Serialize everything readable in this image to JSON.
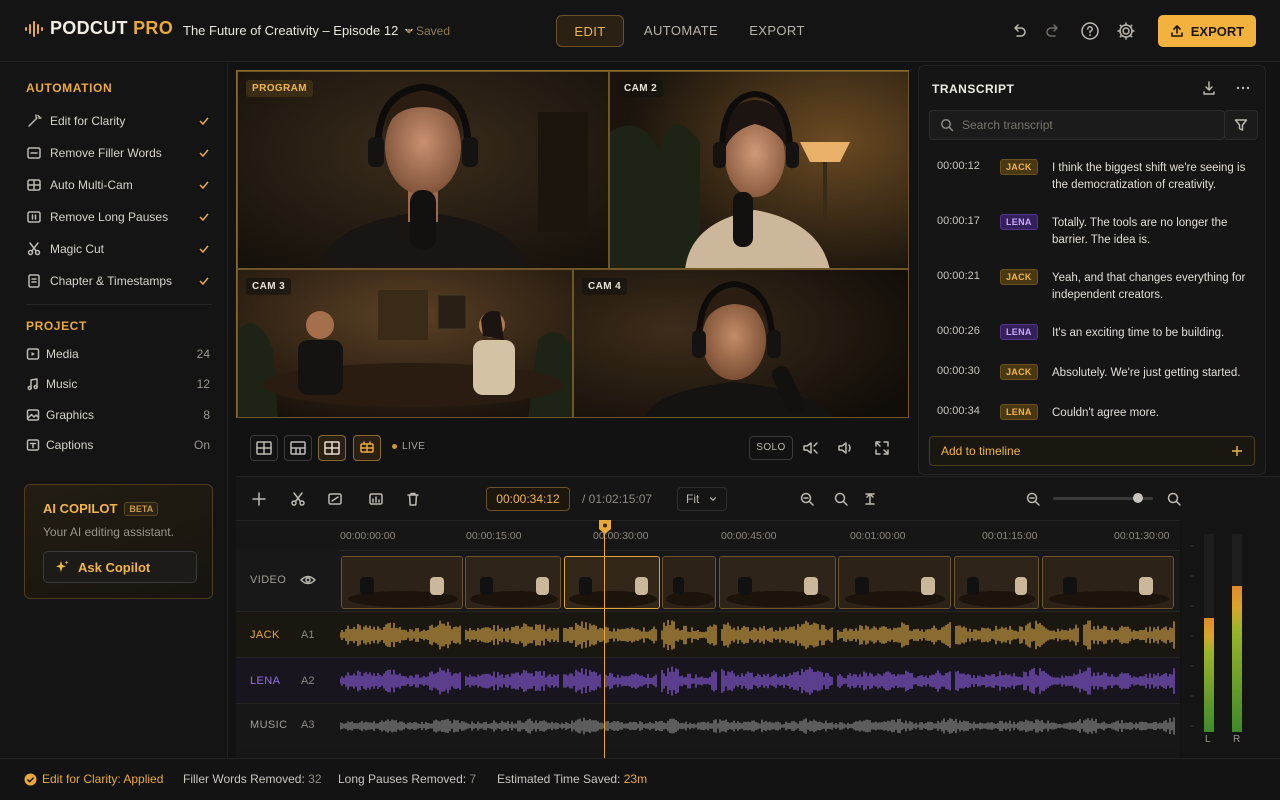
{
  "app": {
    "name_main": "PODCUT",
    "name_accent": "PRO"
  },
  "header": {
    "project_title": "The Future of Creativity – Episode 12",
    "saved_label": "Saved",
    "tabs": [
      {
        "label": "EDIT",
        "active": true
      },
      {
        "label": "AUTOMATE",
        "active": false
      },
      {
        "label": "EXPORT",
        "active": false
      }
    ],
    "export_label": "EXPORT"
  },
  "sidebar": {
    "automation_title": "AUTOMATION",
    "automation_items": [
      {
        "label": "Edit for Clarity",
        "icon": "wand-icon",
        "checked": true
      },
      {
        "label": "Remove Filler Words",
        "icon": "filler-icon",
        "checked": true
      },
      {
        "label": "Auto Multi-Cam",
        "icon": "multicam-icon",
        "checked": true
      },
      {
        "label": "Remove Long Pauses",
        "icon": "pause-icon",
        "checked": true
      },
      {
        "label": "Magic Cut",
        "icon": "magic-cut-icon",
        "checked": true
      },
      {
        "label": "Chapter & Timestamps",
        "icon": "chapter-icon",
        "checked": true
      }
    ],
    "project_title": "PROJECT",
    "project_items": [
      {
        "label": "Media",
        "count": "24",
        "icon": "media-icon"
      },
      {
        "label": "Music",
        "count": "12",
        "icon": "music-icon"
      },
      {
        "label": "Graphics",
        "count": "8",
        "icon": "graphics-icon"
      },
      {
        "label": "Captions",
        "count": "On",
        "icon": "captions-icon"
      }
    ],
    "copilot": {
      "title": "AI COPILOT",
      "badge": "BETA",
      "subtitle": "Your AI editing assistant.",
      "button_label": "Ask Copilot"
    }
  },
  "viewer": {
    "tiles": [
      {
        "label": "PROGRAM"
      },
      {
        "label": "CAM 2"
      },
      {
        "label": "CAM 3"
      },
      {
        "label": "CAM 4"
      }
    ],
    "live_label": "LIVE",
    "solo_label": "SOLO"
  },
  "transcript": {
    "title": "TRANSCRIPT",
    "search_placeholder": "Search transcript",
    "entries": [
      {
        "time": "00:00:12",
        "speaker": "JACK",
        "text": "I think the biggest shift we're seeing is the democratization of creativity."
      },
      {
        "time": "00:00:17",
        "speaker": "LENA",
        "text": "Totally. The tools are no longer the barrier. The idea is."
      },
      {
        "time": "00:00:21",
        "speaker": "JACK",
        "text": "Yeah, and that changes everything for independent creators."
      },
      {
        "time": "00:00:26",
        "speaker": "LENA",
        "text": "It's an exciting time to be building."
      },
      {
        "time": "00:00:30",
        "speaker": "JACK",
        "text": "Absolutely. We're just getting started."
      },
      {
        "time": "00:00:34",
        "speaker": "LENA",
        "text": "Couldn't agree more."
      }
    ],
    "add_button_label": "Add to timeline"
  },
  "timeline": {
    "current_time": "00:00:34:12",
    "total_time": "/ 01:02:15:07",
    "zoom_label": "Fit",
    "zoom_level": 0.85,
    "ruler": [
      "00:00:00:00",
      "00:00:15:00",
      "00:00:30:00",
      "00:00:45:00",
      "00:01:00:00",
      "00:01:15:00",
      "00:01:30:00"
    ],
    "tracks": [
      {
        "label": "VIDEO",
        "sub": ""
      },
      {
        "label": "JACK",
        "sub": "A1"
      },
      {
        "label": "LENA",
        "sub": "A2"
      },
      {
        "label": "MUSIC",
        "sub": "A3"
      }
    ],
    "meter_labels": [
      "L",
      "R"
    ],
    "colors": {
      "jack": "#d6a545",
      "lena": "#8a5ad8",
      "music": "#8a8a8a",
      "accent": "#e9a93a"
    }
  },
  "status": {
    "clarity_label": "Edit for Clarity: Applied",
    "filler_label": "Filler Words Removed:",
    "filler_value": "32",
    "pauses_label": "Long Pauses Removed:",
    "pauses_value": "7",
    "saved_label": "Estimated Time Saved:",
    "saved_value": "23m"
  }
}
